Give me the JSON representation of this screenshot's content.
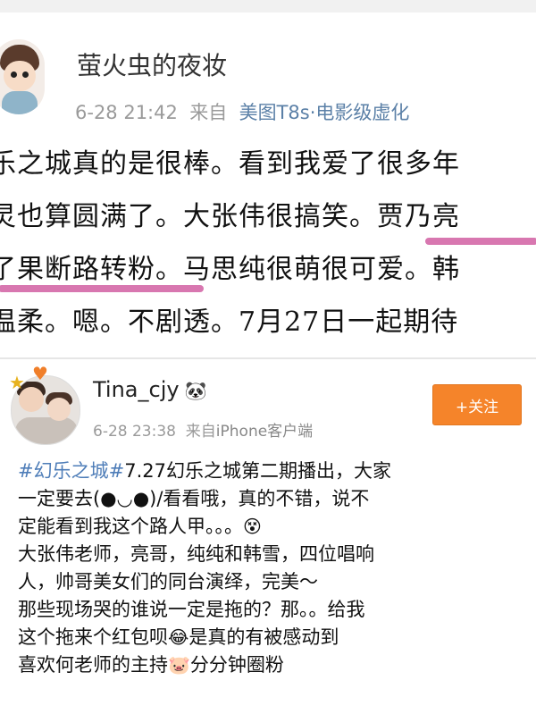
{
  "post1": {
    "author": "萤火虫的夜妆",
    "time": "6-28 21:42",
    "from": "来自",
    "source": "美图T8s·电影级虚化",
    "lines": [
      "乐之城真的是很棒。看到我爱了很多年",
      "灵也算圆满了。大张伟很搞笑。贾乃亮",
      "了果断路转粉。马思纯很萌很可爱。韩",
      "温柔。嗯。不剧透。7月27日一起期待"
    ]
  },
  "post2": {
    "author": "Tina_cjy",
    "author_badge": "🐼",
    "time": "6-28 23:38",
    "from": "来自",
    "source": "iPhone客户端",
    "follow_label": "+关注",
    "hashtag": "#幻乐之城#",
    "line1_rest": "7.27幻乐之城第二期播出，大家",
    "line2": "一定要去(●◡●)/看看哦，真的不错，说不",
    "line3": "定能看到我这个路人甲。。。",
    "line3_emoji": "😵",
    "line4": "大张伟老师，亮哥，纯纯和韩雪，四位唱响",
    "line5": "人，帅哥美女们的同台演绎，完美～",
    "line6": "那些现场哭的谁说一定是拖的？那。。给我",
    "line7_a": "这个拖来个红包呗",
    "line7_emoji": "😂",
    "line7_b": "是真的有被感动到",
    "line8_a": "喜欢何老师的主持",
    "line8_emoji": "🐷",
    "line8_b": "分分钟圈粉"
  }
}
